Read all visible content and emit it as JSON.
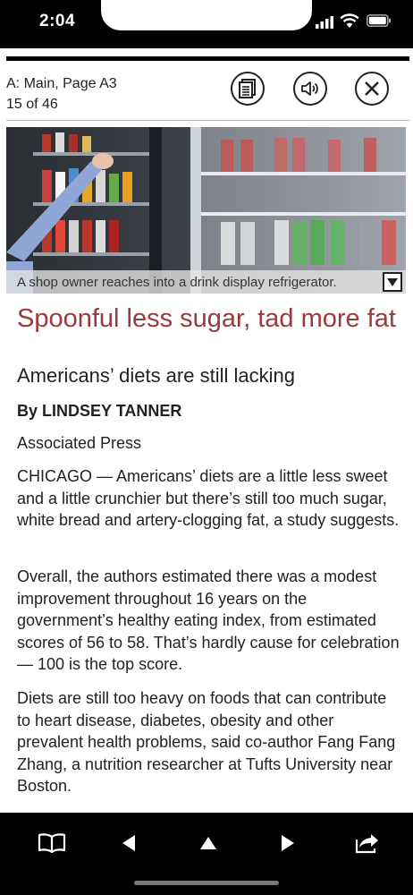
{
  "status_bar": {
    "time": "2:04"
  },
  "header": {
    "section": "A: Main, Page A3",
    "page_counter": "15 of 46",
    "buttons": [
      {
        "icon": "article-list-icon"
      },
      {
        "icon": "speaker-icon"
      },
      {
        "icon": "close-icon"
      }
    ]
  },
  "photo": {
    "caption": "A shop owner reaches into a drink display refrigerator."
  },
  "article": {
    "headline": "Spoonful less sugar, tad more fat",
    "subhead": "Americans’ diets are still lacking",
    "byline": "By LINDSEY TANNER",
    "source": "Associated Press",
    "paragraphs": [
      "CHICAGO — Americans’ diets are a little less sweet and a little crunchier but there’s still too much sugar, white bread and artery-clogging fat, a study suggests.",
      "Overall, the authors estimated there was a modest improvement throughout 16 years on the government’s healthy eating index, from estimated scores of 56 to 58. That’s hardly cause for celebration — 100 is the top score.",
      "Diets are still too heavy on foods that can contribute to heart disease, diabetes, obesity and other prevalent health problems, said co-author Fang Fang Zhang, a nutrition researcher at Tufts University near Boston."
    ]
  },
  "toolbar": {
    "buttons": [
      {
        "icon": "book-icon"
      },
      {
        "icon": "previous-icon"
      },
      {
        "icon": "up-icon"
      },
      {
        "icon": "next-icon"
      },
      {
        "icon": "share-icon"
      }
    ]
  },
  "colors": {
    "headline": "#9a3b3b",
    "bars": "#000000"
  }
}
